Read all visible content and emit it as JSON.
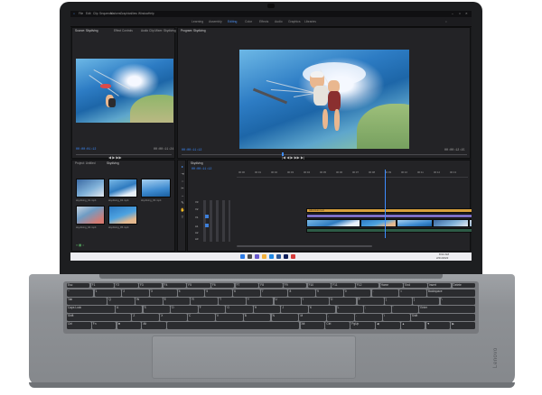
{
  "menu": [
    "File",
    "Edit",
    "Clip",
    "Sequence",
    "Markers",
    "Graphics",
    "View",
    "Window",
    "Help"
  ],
  "workspaces": [
    {
      "label": "Learning",
      "active": false
    },
    {
      "label": "Assembly",
      "active": false
    },
    {
      "label": "Editing",
      "active": true
    },
    {
      "label": "Color",
      "active": false
    },
    {
      "label": "Effects",
      "active": false
    },
    {
      "label": "Audio",
      "active": false
    },
    {
      "label": "Graphics",
      "active": false
    },
    {
      "label": "Libraries",
      "active": false
    }
  ],
  "source_panel": {
    "tabs": [
      "Source: Skydiving",
      "Effect Controls",
      "Audio Clip Mixer: Skydiving"
    ],
    "timecode_in": "00:00:01:12",
    "timecode_out": "00:00:11:24"
  },
  "program_panel": {
    "tab": "Program: Skydiving",
    "timecode_in": "00:00:11:12",
    "timecode_out": "00:00:12:15"
  },
  "project_panel": {
    "tabs": [
      "Project: Untitled",
      "Skydiving"
    ],
    "clips": [
      "skydiving_01.mp4",
      "skydiving_02.mp4",
      "skydiving_03.mp4",
      "skydiving_04.mp4",
      "skydiving_05.mp4"
    ]
  },
  "timeline": {
    "tab": "Skydiving",
    "timecode": "00:00:11:12",
    "ruler": [
      "00:00",
      "00:01",
      "00:02",
      "00:03",
      "00:04",
      "00:05",
      "00:06",
      "00:07",
      "00:08",
      "00:09",
      "00:10",
      "00:11",
      "00:12",
      "00:13"
    ],
    "tracks": [
      "V3",
      "V2",
      "V1",
      "A1",
      "A2",
      "A3"
    ],
    "title_clip": "Adventure text"
  },
  "taskbar": {
    "time": "8:02 AM",
    "date": "2/21/2022"
  },
  "keyboard": {
    "row0": [
      "Esc",
      "F1",
      "F2",
      "F3",
      "F4",
      "F5",
      "F6",
      "F7",
      "F8",
      "F9",
      "F10",
      "F11",
      "F12",
      "Home",
      "End",
      "Insert",
      "Delete"
    ],
    "row1": [
      "~",
      "1",
      "2",
      "3",
      "4",
      "5",
      "6",
      "7",
      "8",
      "9",
      "0",
      "-",
      "=",
      "Backspace"
    ],
    "row2": [
      "Tab",
      "Q",
      "W",
      "E",
      "R",
      "T",
      "Y",
      "U",
      "I",
      "O",
      "P",
      "[",
      "]",
      "\\"
    ],
    "row3": [
      "Caps Lock",
      "A",
      "S",
      "D",
      "F",
      "G",
      "H",
      "J",
      "K",
      "L",
      ";",
      "'",
      "Enter"
    ],
    "row4": [
      "Shift",
      "Z",
      "X",
      "C",
      "V",
      "B",
      "N",
      "M",
      ",",
      ".",
      "/",
      "Shift"
    ],
    "row5": [
      "Ctrl",
      "Fn",
      "⊞",
      "Alt",
      "",
      "Alt",
      "Ctrl",
      "PgUp",
      "◀",
      "▲",
      "▼",
      "▶"
    ]
  },
  "brand": "Lenovo"
}
